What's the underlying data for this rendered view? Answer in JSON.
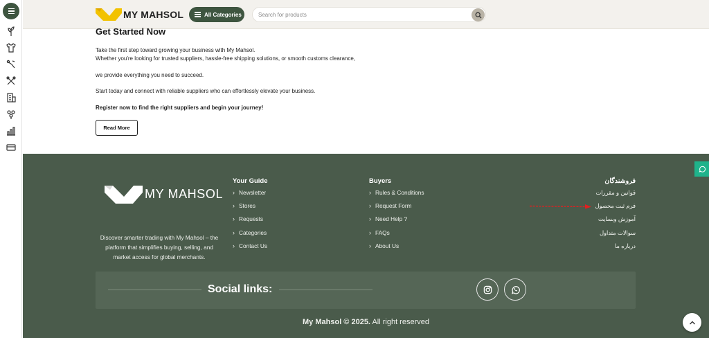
{
  "header": {
    "logo_text": "MY MAHSOL",
    "all_categories_label": "All Categories",
    "search_placeholder": "Search for products"
  },
  "rail": {
    "icons": [
      "menu-icon",
      "sprout-icon",
      "shirt-icon",
      "tool-icon",
      "wrench-cross-icon",
      "building-icon",
      "flowers-icon",
      "chart-icon",
      "card-icon"
    ]
  },
  "content": {
    "title": "Get Started Now",
    "line1": "Take the first step toward growing your business with My Mahsol.",
    "line2": "Whether you're looking for trusted suppliers, hassle-free shipping solutions, or smooth customs clearance,",
    "line3": "we provide everything you need to succeed.",
    "line4": "Start today and connect with reliable suppliers who can effortlessly elevate your business.",
    "line5": "Register now to find the right suppliers and begin your journey!",
    "read_more": "Read More"
  },
  "footer": {
    "logo_text": "MY MAHSOL",
    "description": "Discover smarter trading with My Mahsol – the platform that simplifies buying, selling, and market access for global merchants.",
    "your_guide": {
      "title": "Your Guide",
      "items": [
        "Newsletter",
        "Stores",
        "Requests",
        "Categories",
        "Contact Us"
      ]
    },
    "buyers": {
      "title": "Buyers",
      "items": [
        "Rules & Conditions",
        "Request Form",
        "Need Help ?",
        "FAQs",
        "About Us"
      ]
    },
    "sellers": {
      "title": "فروشندگان",
      "items": [
        "قوانین و مقررات",
        "فرم ثبت محصول",
        "آموزش وبسایت",
        "سوالات متداول",
        "درباره ما"
      ]
    },
    "social_label": "Social links:",
    "copyright_bold": "My Mahsol © 2025.",
    "copyright_rest": " All right reserved"
  },
  "colors": {
    "brand_green": "#3e5540",
    "footer_bg": "#4a5b4b",
    "logo_yellow": "#f2c200",
    "whatsapp_teal": "#1fb38b",
    "annotation_red": "#e02020"
  }
}
